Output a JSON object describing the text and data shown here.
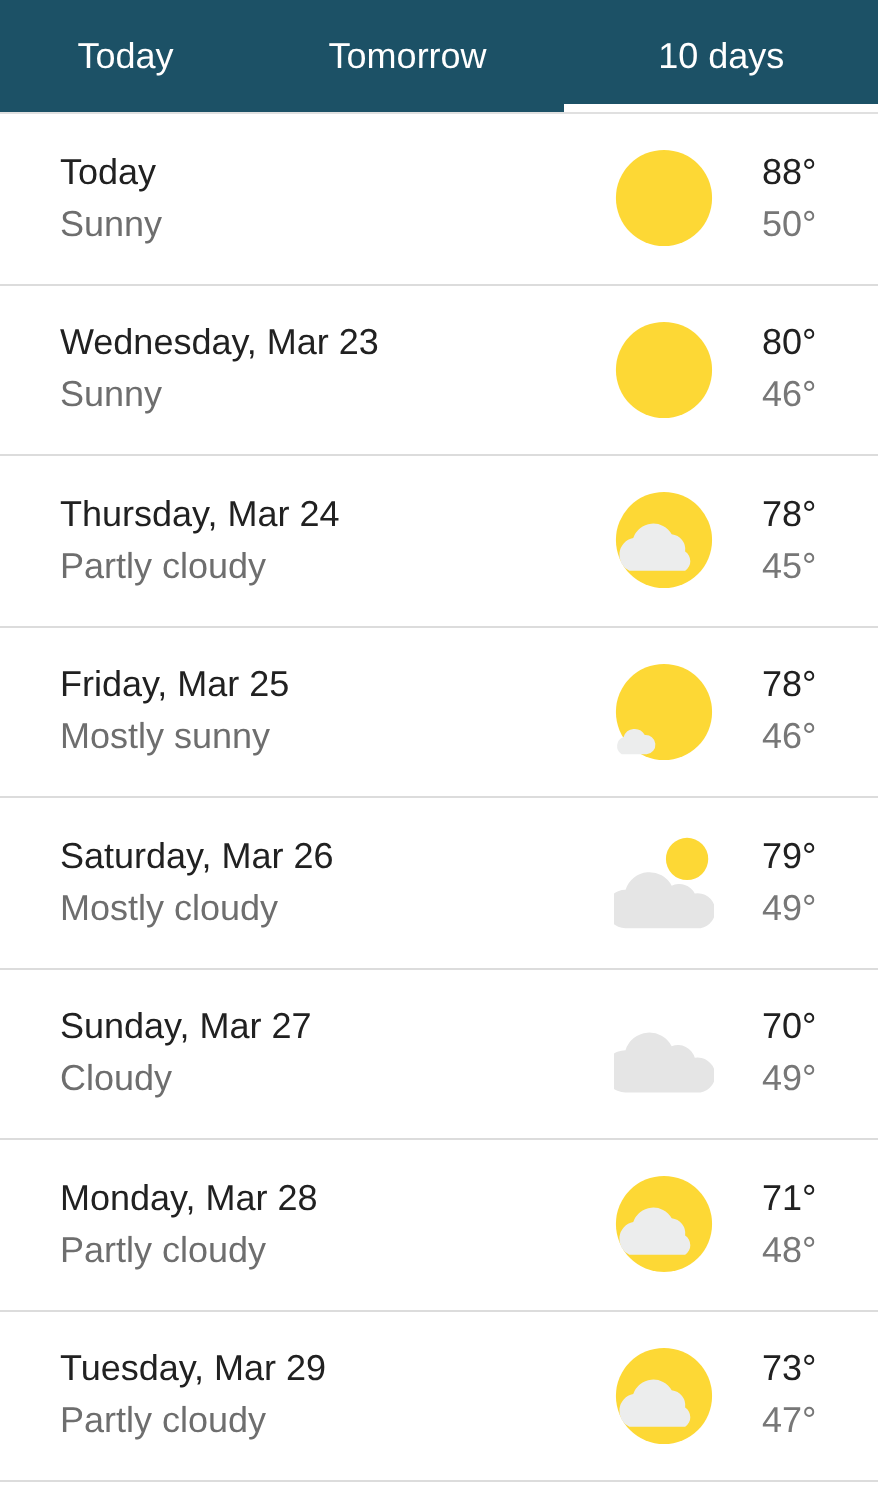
{
  "tabs": [
    {
      "label": "Today",
      "selected": false
    },
    {
      "label": "Tomorrow",
      "selected": false
    },
    {
      "label": "10 days",
      "selected": true
    }
  ],
  "days": [
    {
      "day": "Today",
      "condition": "Sunny",
      "kind": "sunny",
      "high": "88°",
      "low": "50°"
    },
    {
      "day": "Wednesday, Mar 23",
      "condition": "Sunny",
      "kind": "sunny",
      "high": "80°",
      "low": "46°"
    },
    {
      "day": "Thursday, Mar 24",
      "condition": "Partly cloudy",
      "kind": "partly_cloudy",
      "high": "78°",
      "low": "45°"
    },
    {
      "day": "Friday, Mar 25",
      "condition": "Mostly sunny",
      "kind": "mostly_sunny",
      "high": "78°",
      "low": "46°"
    },
    {
      "day": "Saturday, Mar 26",
      "condition": "Mostly cloudy",
      "kind": "mostly_cloudy",
      "high": "79°",
      "low": "49°"
    },
    {
      "day": "Sunday, Mar 27",
      "condition": "Cloudy",
      "kind": "cloudy",
      "high": "70°",
      "low": "49°"
    },
    {
      "day": "Monday, Mar 28",
      "condition": "Partly cloudy",
      "kind": "partly_cloudy",
      "high": "71°",
      "low": "48°"
    },
    {
      "day": "Tuesday, Mar 29",
      "condition": "Partly cloudy",
      "kind": "partly_cloudy",
      "high": "73°",
      "low": "47°"
    }
  ]
}
